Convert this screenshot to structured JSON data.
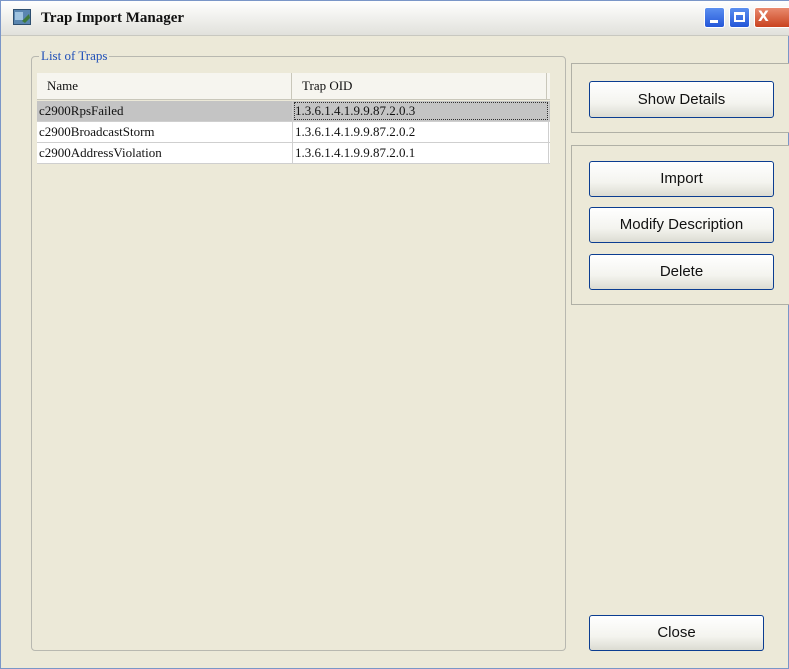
{
  "window": {
    "title": "Trap Import Manager",
    "icon": "app-window-icon",
    "controls": [
      "minimize-icon",
      "maximize-icon",
      "close-icon"
    ],
    "close_glyph": "X"
  },
  "group": {
    "legend": "List of Traps"
  },
  "table": {
    "columns": [
      "Name",
      "Trap OID"
    ],
    "rows": [
      {
        "name": "c2900RpsFailed",
        "oid": "1.3.6.1.4.1.9.9.87.2.0.3",
        "selected": true
      },
      {
        "name": "c2900BroadcastStorm",
        "oid": "1.3.6.1.4.1.9.9.87.2.0.2",
        "selected": false
      },
      {
        "name": "c2900AddressViolation",
        "oid": "1.3.6.1.4.1.9.9.87.2.0.1",
        "selected": false
      }
    ]
  },
  "buttons": {
    "show_details": "Show Details",
    "import": "Import",
    "modify_description": "Modify Description",
    "delete": "Delete",
    "close": "Close"
  },
  "colors": {
    "legend_text": "#1f4fb8",
    "selected_row": "#c4c4c4",
    "window_bg": "#ece9d8"
  }
}
